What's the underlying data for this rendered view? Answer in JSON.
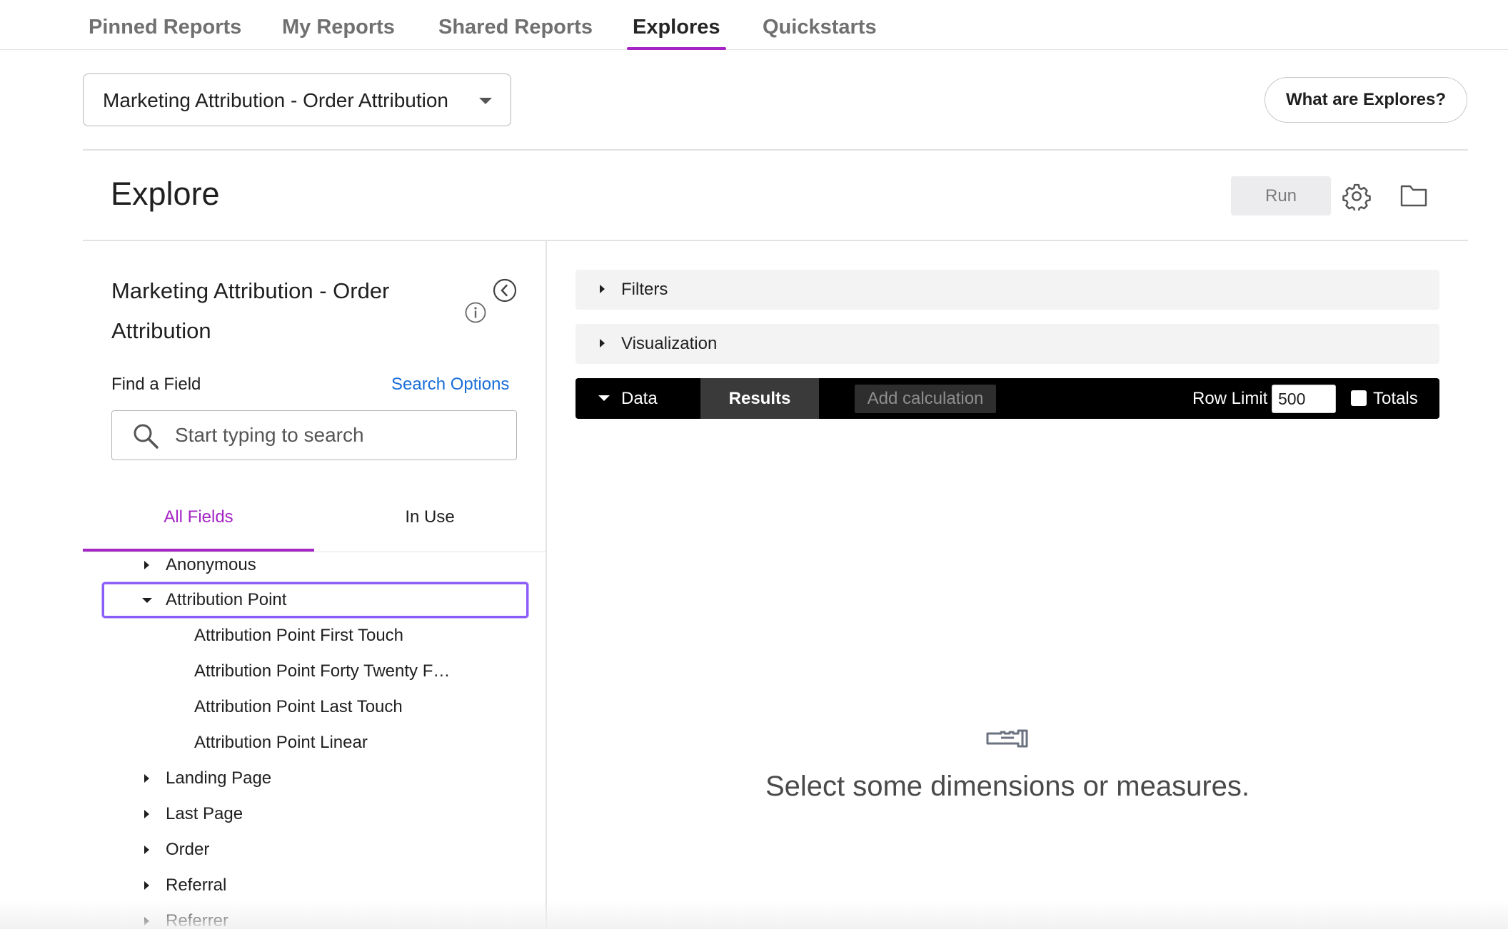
{
  "top_nav": {
    "tabs": [
      {
        "label": "Pinned Reports",
        "active": false
      },
      {
        "label": "My Reports",
        "active": false
      },
      {
        "label": "Shared Reports",
        "active": false
      },
      {
        "label": "Explores",
        "active": true
      },
      {
        "label": "Quickstarts",
        "active": false
      }
    ],
    "accent_color": "#a524c4"
  },
  "explore_selector": {
    "value": "Marketing Attribution - Order Attribution",
    "icon": "chevron-down-icon"
  },
  "help_button": {
    "label": "What are Explores?"
  },
  "explore_header": {
    "title": "Explore",
    "run_label": "Run",
    "settings_icon": "gear-icon",
    "folder_icon": "folder-icon"
  },
  "field_panel": {
    "title": "Marketing Attribution - Order Attribution",
    "find_label": "Find a Field",
    "search_options_label": "Search Options",
    "search_placeholder": "Start typing to search",
    "tabs": {
      "all": "All Fields",
      "in_use": "In Use"
    },
    "tree": [
      {
        "label": "Anonymous",
        "expanded": false
      },
      {
        "label": "Attribution Point",
        "expanded": true,
        "selected": true,
        "children": [
          "Attribution Point First Touch",
          "Attribution Point Forty Twenty F…",
          "Attribution Point Last Touch",
          "Attribution Point Linear"
        ]
      },
      {
        "label": "Landing Page",
        "expanded": false
      },
      {
        "label": "Last Page",
        "expanded": false
      },
      {
        "label": "Order",
        "expanded": false
      },
      {
        "label": "Referral",
        "expanded": false
      },
      {
        "label": "Referrer",
        "expanded": false
      }
    ],
    "selection_color": "#8b5cf6"
  },
  "query_panel": {
    "filters_label": "Filters",
    "visualization_label": "Visualization",
    "data_label": "Data",
    "results_label": "Results",
    "add_calculation_label": "Add calculation",
    "row_limit_label": "Row Limit",
    "row_limit_value": "500",
    "totals_label": "Totals",
    "totals_checked": false,
    "empty_state_icon": "binoculars-icon",
    "empty_state_text": "Select some dimensions or measures."
  }
}
